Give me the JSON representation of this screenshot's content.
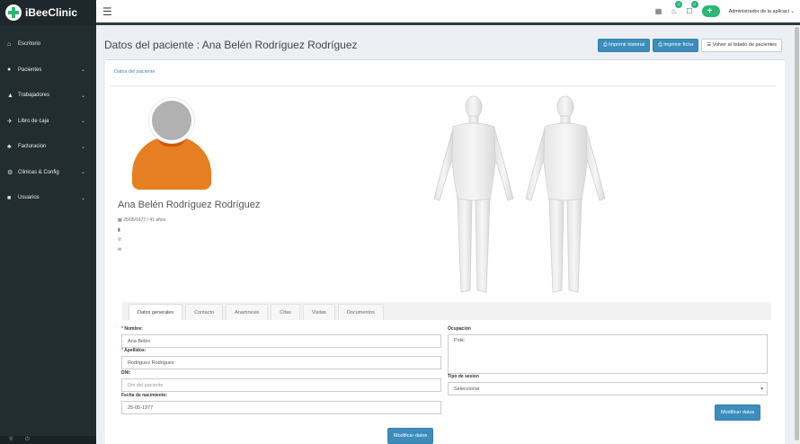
{
  "app": {
    "logo_text": "iBeeClinic"
  },
  "sidebar": {
    "items": [
      {
        "label": "Escritorio",
        "icon": "home-icon"
      },
      {
        "label": "Pacientes",
        "icon": "users-icon"
      },
      {
        "label": "Trabajadores",
        "icon": "user-icon"
      },
      {
        "label": "Libro de caja",
        "icon": "plane-icon"
      },
      {
        "label": "Facturacion",
        "icon": "handshake-icon"
      },
      {
        "label": "Clinicas & Config",
        "icon": "cogs-icon"
      },
      {
        "label": "Usuarios",
        "icon": "lock-icon"
      }
    ]
  },
  "topbar": {
    "calendar_icon": "calendar-icon",
    "notif_badge": "0",
    "tasks_badge": "0",
    "user_label": "Administrador de la aplicaci"
  },
  "header": {
    "title": "Datos del paciente : Ana Belén Rodríguez Rodríguez",
    "btn_print_history": "Imprimir historial",
    "btn_print_sheet": "Imprimir ficha",
    "btn_back": "Volver al listado de pacientes"
  },
  "box": {
    "title": "Datos del paciente"
  },
  "patient": {
    "name": "Ana Belén Rodríguez Rodríguez",
    "birth": "25/05/1977 / 41 años"
  },
  "tabs": [
    "Datos generales",
    "Contacto",
    "Anamnesis",
    "Citas",
    "Visitas",
    "Documentos"
  ],
  "form": {
    "nombre_label": "Nombre:",
    "nombre_value": "Ana Belén",
    "apellidos_label": "Apellidos:",
    "apellidos_value": "Rodriguez Rodriguez",
    "dni_label": "DNI:",
    "dni_placeholder": "Dni del paciente",
    "fecha_label": "Fecha de nacimiento:",
    "fecha_value": "25-05-1977",
    "ocupacion_label": "Ocupación",
    "ocupacion_value": "Polic",
    "tipo_label": "Tipo de sesion",
    "tipo_value": "Seleccionar",
    "save_left": "Modificar datos",
    "save_right": "Modificar datos"
  },
  "colors": {
    "primary": "#3c8dbc",
    "sidebar": "#222d32",
    "brand": "#2bb673",
    "avatar_body": "#e67e22"
  }
}
